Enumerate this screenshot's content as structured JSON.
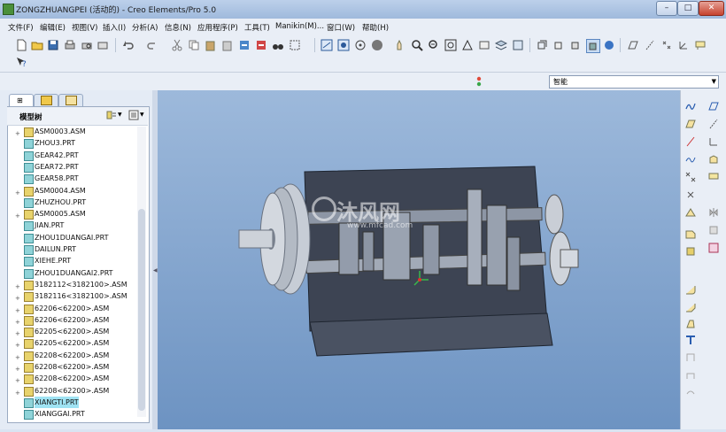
{
  "window": {
    "title": "ZONGZHUANGPEI (活动的) - Creo Elements/Pro 5.0",
    "controls": [
      "–",
      "□",
      "✕"
    ]
  },
  "menubar": {
    "items": [
      "文件(F)",
      "编辑(E)",
      "视图(V)",
      "插入(I)",
      "分析(A)",
      "信息(N)",
      "应用程序(P)",
      "工具(T)",
      "Manikin(M)...",
      "窗口(W)",
      "帮助(H)"
    ]
  },
  "secondary_bar": {
    "selection_filter": "智能"
  },
  "model_tree": {
    "header": "模型树",
    "items": [
      {
        "label": "ASM0003.ASM",
        "type": "asm",
        "expand": "+"
      },
      {
        "label": "ZHOU3.PRT",
        "type": "prt",
        "expand": ""
      },
      {
        "label": "GEAR42.PRT",
        "type": "prt",
        "expand": ""
      },
      {
        "label": "GEAR72.PRT",
        "type": "prt",
        "expand": ""
      },
      {
        "label": "GEAR58.PRT",
        "type": "prt",
        "expand": ""
      },
      {
        "label": "ASM0004.ASM",
        "type": "asm",
        "expand": "+"
      },
      {
        "label": "ZHUZHOU.PRT",
        "type": "prt",
        "expand": ""
      },
      {
        "label": "ASM0005.ASM",
        "type": "asm",
        "expand": "+"
      },
      {
        "label": "JIAN.PRT",
        "type": "prt",
        "expand": ""
      },
      {
        "label": "ZHOU1DUANGAI.PRT",
        "type": "prt",
        "expand": ""
      },
      {
        "label": "DAILUN.PRT",
        "type": "prt",
        "expand": ""
      },
      {
        "label": "XIEHE.PRT",
        "type": "prt",
        "expand": ""
      },
      {
        "label": "ZHOU1DUANGAI2.PRT",
        "type": "prt",
        "expand": ""
      },
      {
        "label": "3182112<3182100>.ASM",
        "type": "asm",
        "expand": "+"
      },
      {
        "label": "3182116<3182100>.ASM",
        "type": "asm",
        "expand": "+"
      },
      {
        "label": "62206<62200>.ASM",
        "type": "asm",
        "expand": "+"
      },
      {
        "label": "62206<62200>.ASM",
        "type": "asm",
        "expand": "+"
      },
      {
        "label": "62205<62200>.ASM",
        "type": "asm",
        "expand": "+"
      },
      {
        "label": "62205<62200>.ASM",
        "type": "asm",
        "expand": "+"
      },
      {
        "label": "62208<62200>.ASM",
        "type": "asm",
        "expand": "+"
      },
      {
        "label": "62208<62200>.ASM",
        "type": "asm",
        "expand": "+"
      },
      {
        "label": "62208<62200>.ASM",
        "type": "asm",
        "expand": "+"
      },
      {
        "label": "62208<62200>.ASM",
        "type": "asm",
        "expand": "+"
      },
      {
        "label": "XIANGTI.PRT",
        "type": "prt",
        "expand": "",
        "selected": true
      },
      {
        "label": "XIANGGAI.PRT",
        "type": "prt",
        "expand": ""
      }
    ]
  },
  "watermark": {
    "brand": "沐风网",
    "url": "www.mfcad.com"
  },
  "colors": {
    "viewport_top": "#9db9db",
    "viewport_bottom": "#6d93c2",
    "housing": "#3d4453",
    "selection": "#9fe3f3"
  }
}
